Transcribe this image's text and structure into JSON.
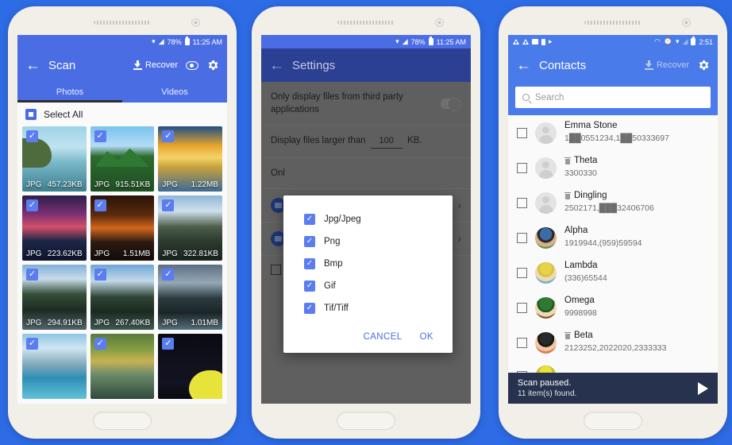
{
  "theme": {
    "page_background": "#2e6ce6",
    "accent_blue": "#4a6de4",
    "dark_blue": "#2b3f93",
    "checkbox_blue": "#5b7df0",
    "scan_bar": "#27324f"
  },
  "phone1": {
    "status_bar": {
      "battery": "78%",
      "clock": "11:25 AM",
      "wifi_icon": "wifi-icon",
      "signal_icon": "signal-icon",
      "battery_icon": "battery-icon"
    },
    "appbar": {
      "back_icon": "back-arrow-icon",
      "title": "Scan",
      "recover_label": "Recover",
      "recover_icon": "download-icon",
      "preview_icon": "eye-icon",
      "settings_icon": "gear-icon"
    },
    "tabs": [
      {
        "label": "Photos",
        "active": true
      },
      {
        "label": "Videos",
        "active": false
      }
    ],
    "select_all": {
      "label": "Select All",
      "checked": true
    },
    "photos": [
      {
        "type": "JPG",
        "size": "457.23KB",
        "checked": true,
        "art": "ph-a"
      },
      {
        "type": "JPG",
        "size": "915.51KB",
        "checked": true,
        "art": "ph-b"
      },
      {
        "type": "JPG",
        "size": "1.22MB",
        "checked": true,
        "art": "ph-c"
      },
      {
        "type": "JPG",
        "size": "223.62KB",
        "checked": true,
        "art": "ph-d"
      },
      {
        "type": "JPG",
        "size": "1.51MB",
        "checked": true,
        "art": "ph-e"
      },
      {
        "type": "JPG",
        "size": "322.81KB",
        "checked": true,
        "art": "ph-f"
      },
      {
        "type": "JPG",
        "size": "294.91KB",
        "checked": true,
        "art": "ph-g"
      },
      {
        "type": "JPG",
        "size": "267.40KB",
        "checked": true,
        "art": "ph-h"
      },
      {
        "type": "JPG",
        "size": "1.01MB",
        "checked": true,
        "art": "ph-i"
      },
      {
        "type": "",
        "size": "",
        "checked": true,
        "art": "ph-j"
      },
      {
        "type": "",
        "size": "",
        "checked": true,
        "art": "ph-k"
      },
      {
        "type": "",
        "size": "",
        "checked": true,
        "art": "ph-l"
      }
    ]
  },
  "phone2": {
    "status_bar": {
      "battery": "78%",
      "clock": "11:25 AM"
    },
    "appbar": {
      "back_icon": "back-arrow-icon",
      "title": "Settings"
    },
    "rows": {
      "third_party_label": "Only display files from third party applications",
      "size_filter_prefix": "Display files larger than",
      "size_filter_value": "100",
      "size_filter_suffix": "KB.",
      "only_label": "Onl"
    },
    "dialog": {
      "options": [
        {
          "label": "Jpg/Jpeg",
          "checked": true
        },
        {
          "label": "Png",
          "checked": true
        },
        {
          "label": "Bmp",
          "checked": true
        },
        {
          "label": "Gif",
          "checked": true
        },
        {
          "label": "Tif/Tiff",
          "checked": true
        }
      ],
      "cancel_label": "CANCEL",
      "ok_label": "OK"
    }
  },
  "phone3": {
    "status_bar": {
      "clock": "2:51",
      "left_icons": [
        "warning-icon",
        "warning-icon",
        "image-icon",
        "sim-icon",
        "flag-icon"
      ],
      "right_icons": [
        "vibrate-icon",
        "key-icon",
        "wifi-icon",
        "signal-off-icon",
        "battery-icon"
      ]
    },
    "appbar": {
      "back_icon": "back-arrow-icon",
      "title": "Contacts",
      "recover_label": "Recover",
      "recover_icon": "download-icon",
      "settings_icon": "gear-icon"
    },
    "search": {
      "placeholder": "Search",
      "icon": "search-icon"
    },
    "contacts": [
      {
        "name": "Emma Stone",
        "number": "1██0551234,1██50333697",
        "deleted": false,
        "avatar": "ghost"
      },
      {
        "name": "Theta",
        "number": "3300330",
        "deleted": true,
        "avatar": "ghost"
      },
      {
        "name": "Dingling",
        "number": "2502171,███32406706",
        "deleted": true,
        "avatar": "ghost"
      },
      {
        "name": "Alpha",
        "number": "1919944,(959)59594",
        "deleted": false,
        "avatar": "a1"
      },
      {
        "name": "Lambda",
        "number": "(336)65544",
        "deleted": false,
        "avatar": "a2"
      },
      {
        "name": "Omega",
        "number": "9998998",
        "deleted": false,
        "avatar": "a3"
      },
      {
        "name": "Beta",
        "number": "2123252,2022020,2333333",
        "deleted": true,
        "avatar": "a4"
      },
      {
        "name": "",
        "number": "",
        "deleted": false,
        "avatar": "a5"
      }
    ],
    "scan_bar": {
      "line1": "Scan paused.",
      "line2": "11 item(s) found.",
      "play_icon": "play-icon"
    }
  }
}
